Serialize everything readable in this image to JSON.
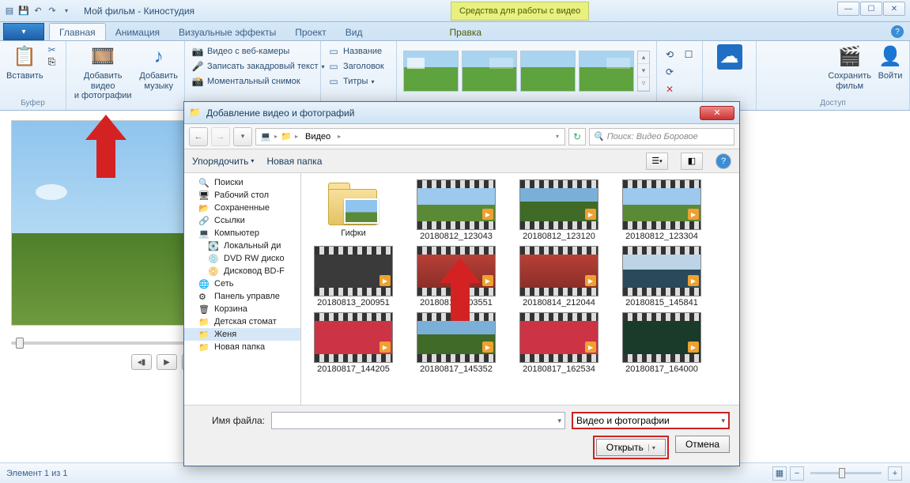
{
  "titlebar": {
    "title": "Мой фильм - Киностудия",
    "context_tab": "Средства для работы с видео"
  },
  "wincontrols": {
    "min": "—",
    "max": "☐",
    "close": "✕"
  },
  "tabs": {
    "home": "Главная",
    "anim": "Анимация",
    "vfx": "Визуальные эффекты",
    "project": "Проект",
    "view": "Вид",
    "edit": "Правка"
  },
  "ribbon": {
    "buffer": {
      "label": "Буфер",
      "paste": "Вставить"
    },
    "add": {
      "video_photo": "Добавить видео\nи фотографии",
      "music": "Добавить\nмузыку"
    },
    "media": {
      "webcam": "Видео с веб-камеры",
      "voiceover": "Записать закадровый текст",
      "snapshot": "Моментальный снимок"
    },
    "text": {
      "name": "Название",
      "header": "Заголовок",
      "titles": "Титры"
    },
    "share": {
      "save": "Сохранить\nфильм",
      "signin": "Войти",
      "label": "Доступ"
    }
  },
  "status": {
    "text": "Элемент 1 из 1"
  },
  "dialog": {
    "title": "Добавление видео и фотографий",
    "breadcrumb": {
      "p1": "Видео"
    },
    "search_placeholder": "Поиск: Видео Боровое",
    "toolbar": {
      "organize": "Упорядочить",
      "newfolder": "Новая папка"
    },
    "tree": [
      "Поиски",
      "Рабочий стол",
      "Сохраненные",
      "Ссылки",
      "Компьютер",
      "Локальный ди",
      "DVD RW диско",
      "Дисковод BD-F",
      "Сеть",
      "Панель управле",
      "Корзина",
      "Детская стомат",
      "Женя",
      "Новая папка"
    ],
    "files": {
      "folder": "Гифки",
      "v": [
        "20180812_123043",
        "20180812_123120",
        "20180812_123304",
        "20180813_200951",
        "20180814_103551",
        "20180814_212044",
        "20180815_145841",
        "20180817_144205",
        "20180817_145352",
        "20180817_162534",
        "20180817_164000"
      ]
    },
    "footer": {
      "filename_label": "Имя файла:",
      "filter": "Видео и фотографии",
      "open": "Открыть",
      "cancel": "Отмена"
    }
  }
}
